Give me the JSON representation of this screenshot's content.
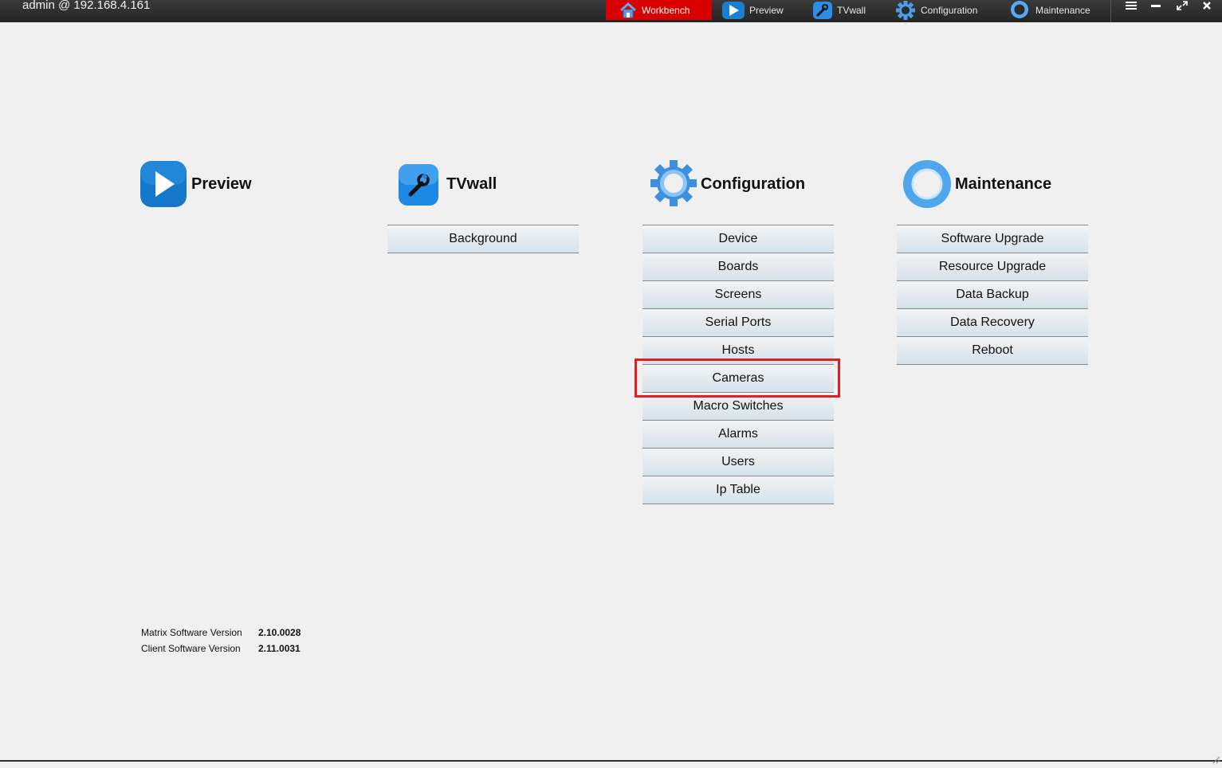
{
  "app": {
    "title": "admin @ 192.168.4.161"
  },
  "nav": {
    "tabs": [
      {
        "label": "Workbench",
        "icon": "home-icon",
        "active": true
      },
      {
        "label": "Preview",
        "icon": "play-icon",
        "active": false
      },
      {
        "label": "TVwall",
        "icon": "wrench-icon",
        "active": false
      },
      {
        "label": "Configuration",
        "icon": "gear-icon",
        "active": false
      },
      {
        "label": "Maintenance",
        "icon": "ring-icon",
        "active": false
      }
    ],
    "window_controls": [
      "menu-icon",
      "minimize-icon",
      "maximize-icon",
      "close-icon"
    ]
  },
  "workbench": {
    "preview": {
      "title": "Preview",
      "icon": "play-icon",
      "items": []
    },
    "tvwall": {
      "title": "TVwall",
      "icon": "wrench-icon",
      "items": [
        "Background"
      ]
    },
    "configuration": {
      "title": "Configuration",
      "icon": "gear-icon",
      "items": [
        "Device",
        "Boards",
        "Screens",
        "Serial Ports",
        "Hosts",
        "Cameras",
        "Macro Switches",
        "Alarms",
        "Users",
        "Ip Table"
      ],
      "highlighted": "Cameras"
    },
    "maintenance": {
      "title": "Maintenance",
      "icon": "ring-icon",
      "items": [
        "Software Upgrade",
        "Resource Upgrade",
        "Data Backup",
        "Data Recovery",
        "Reboot"
      ]
    }
  },
  "versions": {
    "matrix_label": "Matrix Software Version",
    "matrix_value": "2.10.0028",
    "client_label": "Client Software Version",
    "client_value": "2.11.0031"
  },
  "colors": {
    "topbar": "#2b2b2b",
    "active_tab": "#d90000",
    "highlight_border": "#e01e26",
    "background": "#f0f0f0"
  }
}
